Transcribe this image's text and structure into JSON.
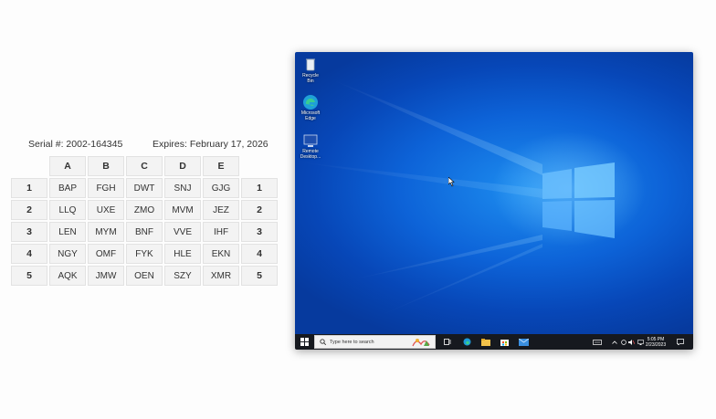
{
  "card": {
    "serial": "Serial #: 2002-164345",
    "expires": "Expires: February 17, 2026",
    "columns": [
      "A",
      "B",
      "C",
      "D",
      "E"
    ],
    "rows": [
      {
        "label": "1",
        "cells": [
          "BAP",
          "FGH",
          "DWT",
          "SNJ",
          "GJG"
        ]
      },
      {
        "label": "2",
        "cells": [
          "LLQ",
          "UXE",
          "ZMO",
          "MVM",
          "JEZ"
        ]
      },
      {
        "label": "3",
        "cells": [
          "LEN",
          "MYM",
          "BNF",
          "VVE",
          "IHF"
        ]
      },
      {
        "label": "4",
        "cells": [
          "NGY",
          "OMF",
          "FYK",
          "HLE",
          "EKN"
        ]
      },
      {
        "label": "5",
        "cells": [
          "AQK",
          "JMW",
          "OEN",
          "SZY",
          "XMR"
        ]
      }
    ]
  },
  "desktop": {
    "icons": [
      {
        "name": "recycle-bin",
        "label": "Recycle Bin"
      },
      {
        "name": "microsoft-edge",
        "label": "Microsoft\nEdge"
      },
      {
        "name": "remote-desktop",
        "label": "Remote\nDesktop..."
      }
    ],
    "colors": {
      "accent": "#0d63d8",
      "taskbar": "#16191f"
    }
  },
  "taskbar": {
    "search_placeholder": "Type here to search",
    "apps": [
      "task-view-icon",
      "edge-icon",
      "file-explorer-icon",
      "store-icon",
      "mail-icon"
    ],
    "tray": {
      "time": "5:05 PM",
      "date": "2/23/2023"
    }
  }
}
